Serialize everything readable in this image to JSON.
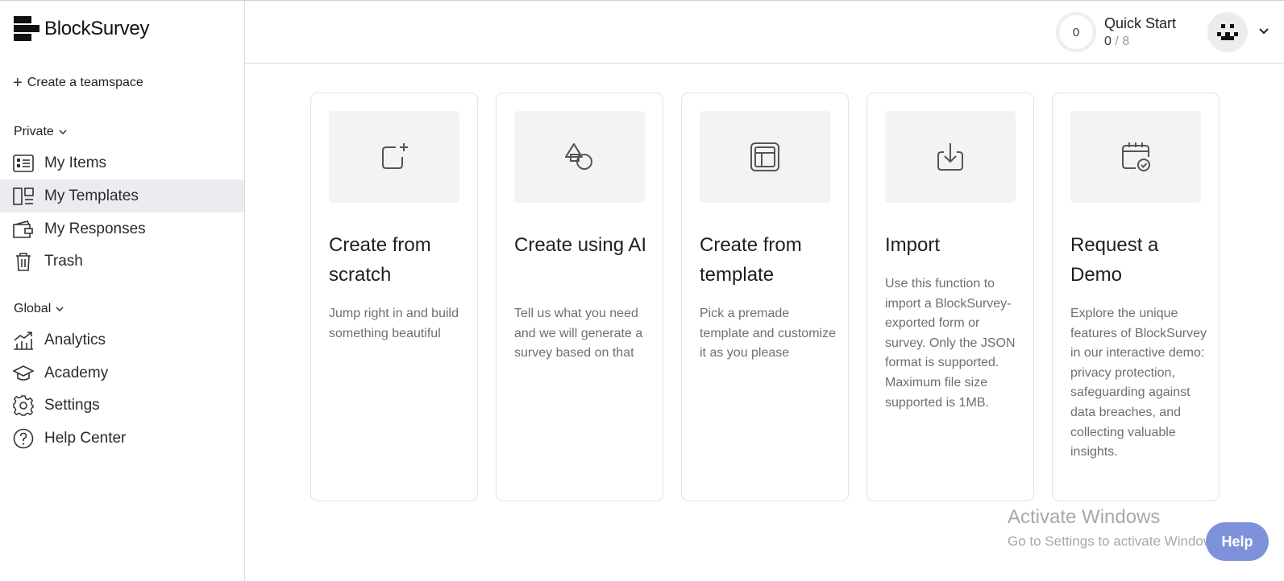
{
  "app": {
    "name": "BlockSurvey"
  },
  "sidebar": {
    "create_teamspace": "Create a teamspace",
    "private_label": "Private",
    "global_label": "Global",
    "private_items": [
      {
        "label": "My Items",
        "icon": "list-icon",
        "active": false
      },
      {
        "label": "My Templates",
        "icon": "templates-icon",
        "active": true
      },
      {
        "label": "My Responses",
        "icon": "wallet-icon",
        "active": false
      },
      {
        "label": "Trash",
        "icon": "trash-icon",
        "active": false
      }
    ],
    "global_items": [
      {
        "label": "Analytics",
        "icon": "analytics-icon"
      },
      {
        "label": "Academy",
        "icon": "graduation-cap-icon"
      },
      {
        "label": "Settings",
        "icon": "gear-icon"
      },
      {
        "label": "Help Center",
        "icon": "help-circle-icon"
      }
    ]
  },
  "header": {
    "quick_start": {
      "title": "Quick Start",
      "ring_value": "0",
      "done": "0",
      "total": "/ 8"
    }
  },
  "cards": [
    {
      "title": "Create from scratch",
      "description": "Jump right in and build something beautiful",
      "icon": "square-plus-icon"
    },
    {
      "title": "Create using AI",
      "description": "Tell us what you need and we will generate a survey based on that",
      "icon": "shapes-icon"
    },
    {
      "title": "Create from template",
      "description": "Pick a premade template and customize it as you please",
      "icon": "layout-icon"
    },
    {
      "title": "Import",
      "description": "Use this function to import a BlockSurvey-exported form or survey. Only the JSON format is supported. Maximum file size supported is 1MB.",
      "icon": "download-icon"
    },
    {
      "title": "Request a Demo",
      "description": "Explore the unique features of BlockSurvey in our interactive demo: privacy protection, safeguarding against data breaches, and collecting valuable insights.",
      "icon": "calendar-check-icon"
    }
  ],
  "watermark": {
    "title": "Activate Windows",
    "subtitle": "Go to Settings to activate Windows."
  },
  "help_button": {
    "label": "Help"
  },
  "colors": {
    "active_nav_bg": "#ececf0",
    "help_button": "#7e92dc",
    "card_icon_bg": "#f3f3f3"
  }
}
